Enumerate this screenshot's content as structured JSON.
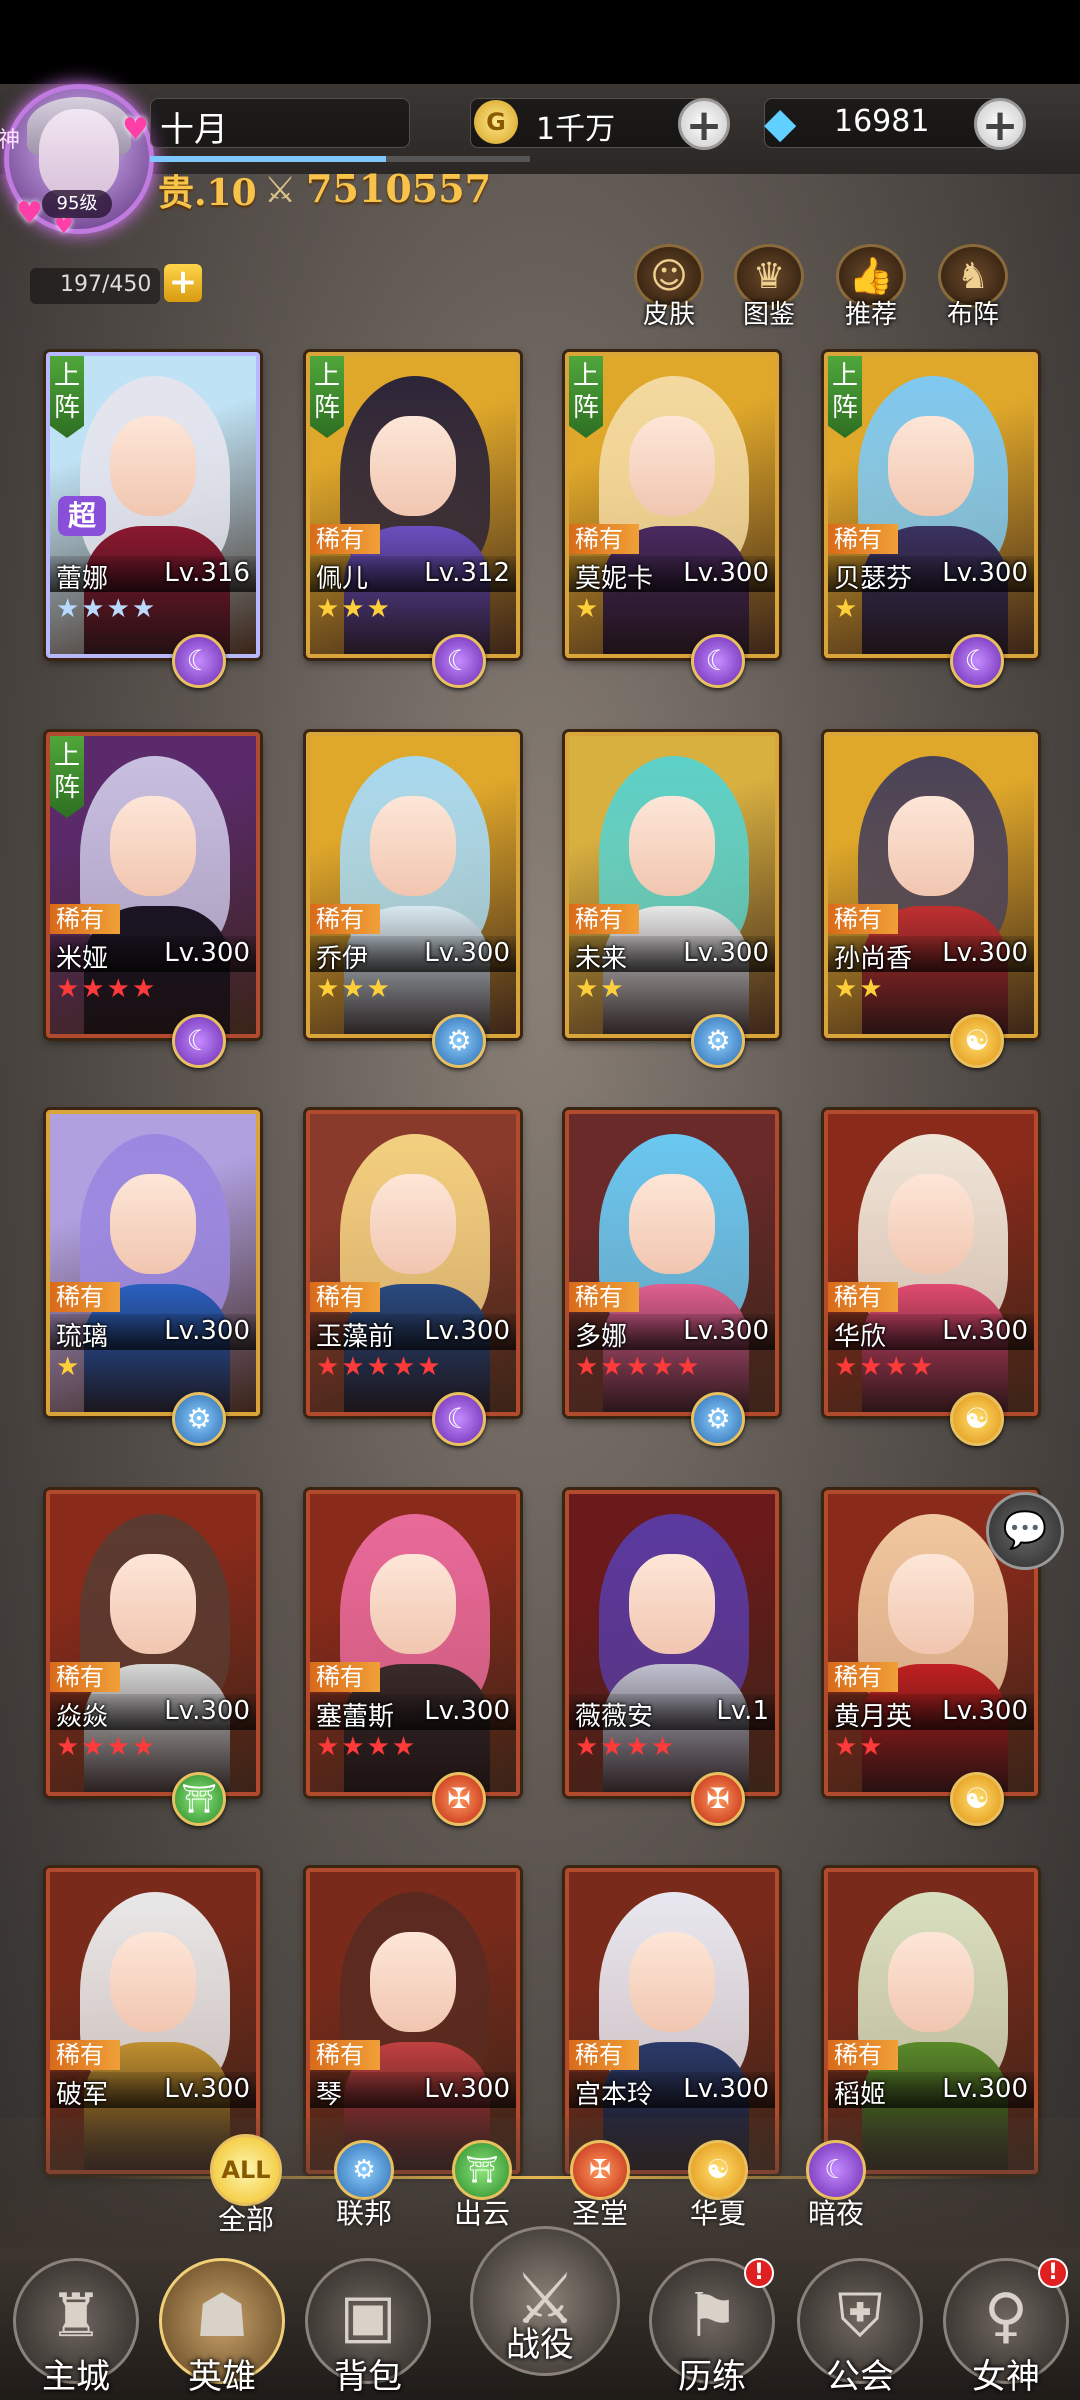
{
  "player": {
    "name": "十月",
    "level_label": "95级",
    "vip_label": "贵.10",
    "power": "7510557",
    "god_tag": "神",
    "exp_progress": 0.62
  },
  "resources": {
    "gold": "1千万",
    "gold_symbol": "G",
    "gems": "16981"
  },
  "hero_capacity": "197/450",
  "top_actions": [
    {
      "label": "皮肤",
      "icon": "mask-icon",
      "glyph": "☺"
    },
    {
      "label": "图鉴",
      "icon": "crown-icon",
      "glyph": "♛"
    },
    {
      "label": "推荐",
      "icon": "thumbs-up-icon",
      "glyph": "👍"
    },
    {
      "label": "布阵",
      "icon": "chess-knight-icon",
      "glyph": "♞"
    }
  ],
  "deploy_label": "上阵",
  "super_label": "超",
  "rarity_label": "稀有",
  "heroes": [
    {
      "name": "蕾娜",
      "level": "Lv.316",
      "stars": "★★★★",
      "star_color": "#b9d9ff",
      "faction": "暗夜",
      "deployed": true,
      "rarity": false,
      "super": true,
      "frame": "purple",
      "art": [
        "#bfe3f5",
        "#e4e4ee",
        "#8b1830"
      ]
    },
    {
      "name": "佩儿",
      "level": "Lv.312",
      "stars": "★★★",
      "star_color": "#ffcf3a",
      "faction": "暗夜",
      "deployed": true,
      "rarity": true,
      "super": false,
      "frame": "gold",
      "art": [
        "#e0a82a",
        "#2c2438",
        "#6a4fbf"
      ]
    },
    {
      "name": "莫妮卡",
      "level": "Lv.300",
      "stars": "★",
      "star_color": "#ffcf3a",
      "faction": "暗夜",
      "deployed": true,
      "rarity": true,
      "super": false,
      "frame": "gold",
      "art": [
        "#e0a82a",
        "#f3d9a0",
        "#4a2a60"
      ]
    },
    {
      "name": "贝瑟芬",
      "level": "Lv.300",
      "stars": "★",
      "star_color": "#ffcf3a",
      "faction": "暗夜",
      "deployed": true,
      "rarity": true,
      "super": false,
      "frame": "gold",
      "art": [
        "#e0a82a",
        "#7fc8f0",
        "#3a3260"
      ]
    },
    {
      "name": "米娅",
      "level": "Lv.300",
      "stars": "★★★★",
      "star_color": "#ff3a3a",
      "faction": "暗夜",
      "deployed": true,
      "rarity": true,
      "super": false,
      "frame": "red",
      "art": [
        "#5a2a6a",
        "#c8c0e0",
        "#1a1424"
      ]
    },
    {
      "name": "乔伊",
      "level": "Lv.300",
      "stars": "★★★",
      "star_color": "#ffcf3a",
      "faction": "联邦",
      "deployed": false,
      "rarity": true,
      "super": false,
      "frame": "gold",
      "art": [
        "#e0a82a",
        "#a8d8f0",
        "#d8e8f0"
      ]
    },
    {
      "name": "未来",
      "level": "Lv.300",
      "stars": "★★",
      "star_color": "#ffcf3a",
      "faction": "联邦",
      "deployed": false,
      "rarity": true,
      "super": false,
      "frame": "gold",
      "art": [
        "#d8b040",
        "#5cd0c8",
        "#e8e8e8"
      ]
    },
    {
      "name": "孙尚香",
      "level": "Lv.300",
      "stars": "★★",
      "star_color": "#ffcf3a",
      "faction": "华夏",
      "deployed": false,
      "rarity": true,
      "super": false,
      "frame": "gold",
      "art": [
        "#e0a82a",
        "#4a4258",
        "#c03030"
      ]
    },
    {
      "name": "琉璃",
      "level": "Lv.300",
      "stars": "★",
      "star_color": "#ffcf3a",
      "faction": "联邦",
      "deployed": false,
      "rarity": true,
      "super": false,
      "frame": "gold",
      "art": [
        "#b0a0e0",
        "#9c88e0",
        "#2a60c0"
      ]
    },
    {
      "name": "玉藻前",
      "level": "Lv.300",
      "stars": "★★★★★",
      "star_color": "#ff3a3a",
      "faction": "暗夜",
      "deployed": false,
      "rarity": true,
      "super": false,
      "frame": "red",
      "art": [
        "#8a3a2a",
        "#f3d080",
        "#2a4a80"
      ]
    },
    {
      "name": "多娜",
      "level": "Lv.300",
      "stars": "★★★★★",
      "star_color": "#ff3a3a",
      "faction": "联邦",
      "deployed": false,
      "rarity": true,
      "super": false,
      "frame": "red",
      "art": [
        "#6a2a2a",
        "#6ac8f0",
        "#e06090"
      ]
    },
    {
      "name": "华欣",
      "level": "Lv.300",
      "stars": "★★★★",
      "star_color": "#ff3a3a",
      "faction": "华夏",
      "deployed": false,
      "rarity": true,
      "super": false,
      "frame": "red",
      "art": [
        "#8a2a1a",
        "#efe6d8",
        "#e04a70"
      ]
    },
    {
      "name": "焱焱",
      "level": "Lv.300",
      "stars": "★★★★",
      "star_color": "#ff3a3a",
      "faction": "出云",
      "deployed": false,
      "rarity": true,
      "super": false,
      "frame": "red",
      "art": [
        "#8a2a1a",
        "#5a3a30",
        "#d8d8d8"
      ]
    },
    {
      "name": "塞蕾斯",
      "level": "Lv.300",
      "stars": "★★★★",
      "star_color": "#ff3a3a",
      "faction": "圣堂",
      "deployed": false,
      "rarity": true,
      "super": false,
      "frame": "red",
      "art": [
        "#8a2a1a",
        "#e86a9a",
        "#3a2a2a"
      ]
    },
    {
      "name": "薇薇安",
      "level": "Lv.1",
      "stars": "★★★★",
      "star_color": "#ff3a3a",
      "faction": "圣堂",
      "deployed": false,
      "rarity": false,
      "super": false,
      "frame": "red",
      "art": [
        "#6a1a1a",
        "#5a3aa0",
        "#c0c0d0"
      ]
    },
    {
      "name": "黄月英",
      "level": "Lv.300",
      "stars": "★★",
      "star_color": "#ff3a3a",
      "faction": "华夏",
      "deployed": false,
      "rarity": true,
      "super": false,
      "frame": "red",
      "art": [
        "#8a2a1a",
        "#f0c8a0",
        "#c02020"
      ]
    },
    {
      "name": "破军",
      "level": "Lv.300",
      "stars": "",
      "star_color": "#ff3a3a",
      "faction": "",
      "deployed": false,
      "rarity": true,
      "super": false,
      "frame": "red",
      "art": [
        "#7a2a1a",
        "#e8e8e8",
        "#c09030"
      ]
    },
    {
      "name": "琴",
      "level": "Lv.300",
      "stars": "",
      "star_color": "#ff3a3a",
      "faction": "",
      "deployed": false,
      "rarity": true,
      "super": false,
      "frame": "red",
      "art": [
        "#7a2a1a",
        "#5a2a20",
        "#c04040"
      ]
    },
    {
      "name": "宫本玲",
      "level": "Lv.300",
      "stars": "",
      "star_color": "#ff3a3a",
      "faction": "",
      "deployed": false,
      "rarity": true,
      "super": false,
      "frame": "red",
      "art": [
        "#7a2a1a",
        "#e8e8f0",
        "#2a3a6a"
      ]
    },
    {
      "name": "稻姬",
      "level": "Lv.300",
      "stars": "",
      "star_color": "#ff3a3a",
      "faction": "",
      "deployed": false,
      "rarity": true,
      "super": false,
      "frame": "red",
      "art": [
        "#7a2a1a",
        "#d8e0c0",
        "#5a8a2a"
      ]
    }
  ],
  "faction_glyphs": {
    "暗夜": "☾",
    "联邦": "⚙",
    "华夏": "☯",
    "出云": "⛩",
    "圣堂": "✠"
  },
  "faction_classes": {
    "暗夜": "fb-dark",
    "联邦": "fb-fed",
    "华夏": "fb-hx",
    "出云": "fb-cy",
    "圣堂": "fb-sh"
  },
  "filters": [
    {
      "label": "全部",
      "glyph": "ALL",
      "icon": "all-filter-icon",
      "active": true,
      "cls": ""
    },
    {
      "label": "联邦",
      "glyph": "⚙",
      "icon": "federation-filter-icon",
      "active": false,
      "cls": "fb-fed"
    },
    {
      "label": "出云",
      "glyph": "⛩",
      "icon": "izumo-filter-icon",
      "active": false,
      "cls": "fb-cy"
    },
    {
      "label": "圣堂",
      "glyph": "✠",
      "icon": "temple-filter-icon",
      "active": false,
      "cls": "fb-sh"
    },
    {
      "label": "华夏",
      "glyph": "☯",
      "icon": "huaxia-filter-icon",
      "active": false,
      "cls": "fb-hx"
    },
    {
      "label": "暗夜",
      "glyph": "☾",
      "icon": "dark-night-filter-icon",
      "active": false,
      "cls": "fb-dark"
    }
  ],
  "nav": [
    {
      "label": "主城",
      "glyph": "♜",
      "icon": "castle-icon",
      "active": false,
      "alert": false
    },
    {
      "label": "英雄",
      "glyph": "☗",
      "icon": "hooded-hero-icon",
      "active": true,
      "alert": false
    },
    {
      "label": "背包",
      "glyph": "▣",
      "icon": "backpack-icon",
      "active": false,
      "alert": false
    },
    {
      "label": "战役",
      "glyph": "⚔",
      "icon": "crossed-swords-icon",
      "active": false,
      "alert": false,
      "center": true
    },
    {
      "label": "历练",
      "glyph": "⚑",
      "icon": "map-icon",
      "active": false,
      "alert": true
    },
    {
      "label": "公会",
      "glyph": "⛨",
      "icon": "guild-shield-icon",
      "active": false,
      "alert": false
    },
    {
      "label": "女神",
      "glyph": "♀",
      "icon": "goddess-icon",
      "active": false,
      "alert": true
    }
  ],
  "alert_mark": "!",
  "chat_glyph": "💬"
}
